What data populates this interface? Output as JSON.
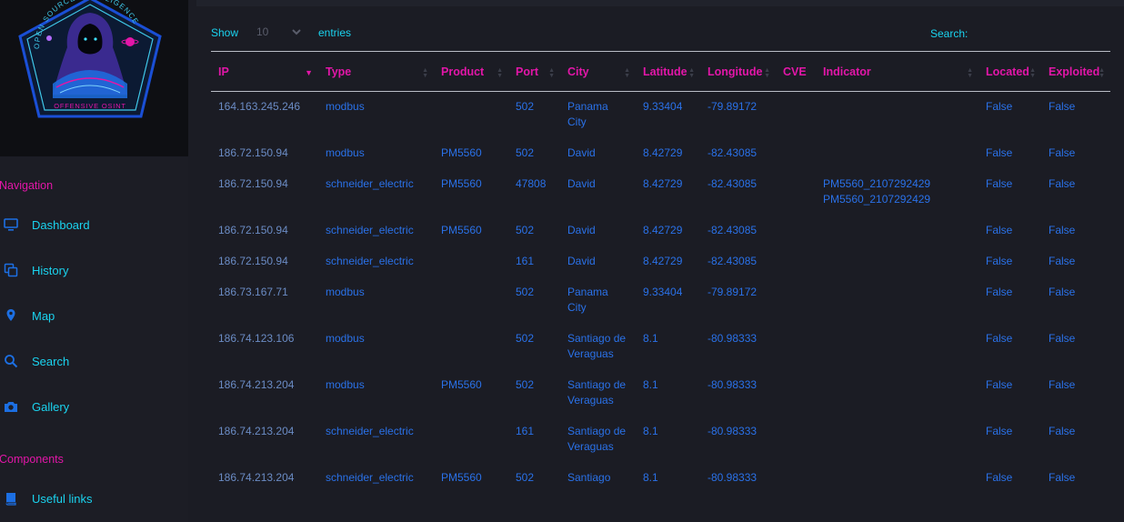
{
  "logo": {
    "top_text": "OPEN SOURCE INTELLIGENCE",
    "bottom_text": "OFFENSIVE OSINT"
  },
  "sidebar": {
    "navigation_heading": "Navigation",
    "items": [
      {
        "label": "Dashboard",
        "icon": "monitor-icon"
      },
      {
        "label": "History",
        "icon": "copy-icon"
      },
      {
        "label": "Map",
        "icon": "map-pin-icon"
      },
      {
        "label": "Search",
        "icon": "search-icon"
      },
      {
        "label": "Gallery",
        "icon": "camera-icon"
      }
    ],
    "components_heading": "Components",
    "components": [
      {
        "label": "Useful links",
        "icon": "book-icon"
      }
    ]
  },
  "table_controls": {
    "show_label": "Show",
    "length_value": "10",
    "entries_label": "entries",
    "search_label": "Search:",
    "search_value": ""
  },
  "table": {
    "columns": [
      "IP",
      "Type",
      "Product",
      "Port",
      "City",
      "Latitude",
      "Longitude",
      "CVE",
      "Indicator",
      "Located",
      "Exploited"
    ],
    "rows": [
      {
        "ip": "164.163.245.246",
        "type": "modbus",
        "product": "",
        "port": "502",
        "city": "Panama City",
        "latitude": "9.33404",
        "longitude": "-79.89172",
        "cve": "",
        "indicator": "",
        "located": "False",
        "exploited": "False"
      },
      {
        "ip": "186.72.150.94",
        "type": "modbus",
        "product": "PM5560",
        "port": "502",
        "city": "David",
        "latitude": "8.42729",
        "longitude": "-82.43085",
        "cve": "",
        "indicator": "",
        "located": "False",
        "exploited": "False"
      },
      {
        "ip": "186.72.150.94",
        "type": "schneider_electric",
        "product": "PM5560",
        "port": "47808",
        "city": "David",
        "latitude": "8.42729",
        "longitude": "-82.43085",
        "cve": "",
        "indicator": "PM5560_2107292429 PM5560_2107292429",
        "located": "False",
        "exploited": "False"
      },
      {
        "ip": "186.72.150.94",
        "type": "schneider_electric",
        "product": "PM5560",
        "port": "502",
        "city": "David",
        "latitude": "8.42729",
        "longitude": "-82.43085",
        "cve": "",
        "indicator": "",
        "located": "False",
        "exploited": "False"
      },
      {
        "ip": "186.72.150.94",
        "type": "schneider_electric",
        "product": "",
        "port": "161",
        "city": "David",
        "latitude": "8.42729",
        "longitude": "-82.43085",
        "cve": "",
        "indicator": "",
        "located": "False",
        "exploited": "False"
      },
      {
        "ip": "186.73.167.71",
        "type": "modbus",
        "product": "",
        "port": "502",
        "city": "Panama City",
        "latitude": "9.33404",
        "longitude": "-79.89172",
        "cve": "",
        "indicator": "",
        "located": "False",
        "exploited": "False"
      },
      {
        "ip": "186.74.123.106",
        "type": "modbus",
        "product": "",
        "port": "502",
        "city": "Santiago de Veraguas",
        "latitude": "8.1",
        "longitude": "-80.98333",
        "cve": "",
        "indicator": "",
        "located": "False",
        "exploited": "False"
      },
      {
        "ip": "186.74.213.204",
        "type": "modbus",
        "product": "PM5560",
        "port": "502",
        "city": "Santiago de Veraguas",
        "latitude": "8.1",
        "longitude": "-80.98333",
        "cve": "",
        "indicator": "",
        "located": "False",
        "exploited": "False"
      },
      {
        "ip": "186.74.213.204",
        "type": "schneider_electric",
        "product": "",
        "port": "161",
        "city": "Santiago de Veraguas",
        "latitude": "8.1",
        "longitude": "-80.98333",
        "cve": "",
        "indicator": "",
        "located": "False",
        "exploited": "False"
      },
      {
        "ip": "186.74.213.204",
        "type": "schneider_electric",
        "product": "PM5560",
        "port": "502",
        "city": "Santiago",
        "latitude": "8.1",
        "longitude": "-80.98333",
        "cve": "",
        "indicator": "",
        "located": "False",
        "exploited": "False"
      }
    ]
  },
  "colors": {
    "accent_pink": "#e216a8",
    "accent_cyan": "#1ad3ef",
    "link_blue": "#2a71e8",
    "background": "#1b1c24"
  }
}
